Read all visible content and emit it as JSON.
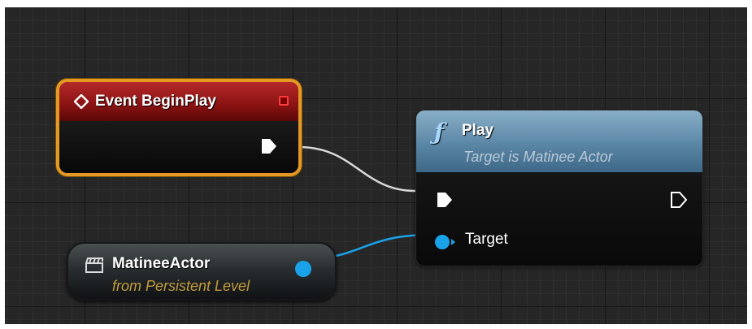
{
  "graph": {
    "event_node": {
      "title": "Event BeginPlay",
      "icon": "event-diamond-icon",
      "border_color": "#e39a25",
      "header_color": "#8a1212"
    },
    "function_node": {
      "icon": "function-icon",
      "icon_glyph": "ƒ",
      "title": "Play",
      "subtitle": "Target is Matinee Actor",
      "header_color": "#5a86a6",
      "input_pin_label": "Target"
    },
    "actor_node": {
      "icon": "clapperboard-icon",
      "title": "MatineeActor",
      "subtitle": "from Persistent Level",
      "subtitle_color": "#c29b3e"
    },
    "pins": {
      "exec_color": "#ffffff",
      "object_pin_color": "#1aa2e8",
      "delegate_pin_color": "#ff3b3b"
    },
    "wires": [
      {
        "from": "Event BeginPlay",
        "to": "Play",
        "type": "exec",
        "color": "#d8d8d8"
      },
      {
        "from": "MatineeActor",
        "to": "Target",
        "type": "object",
        "color": "#1aa2e8"
      }
    ]
  }
}
